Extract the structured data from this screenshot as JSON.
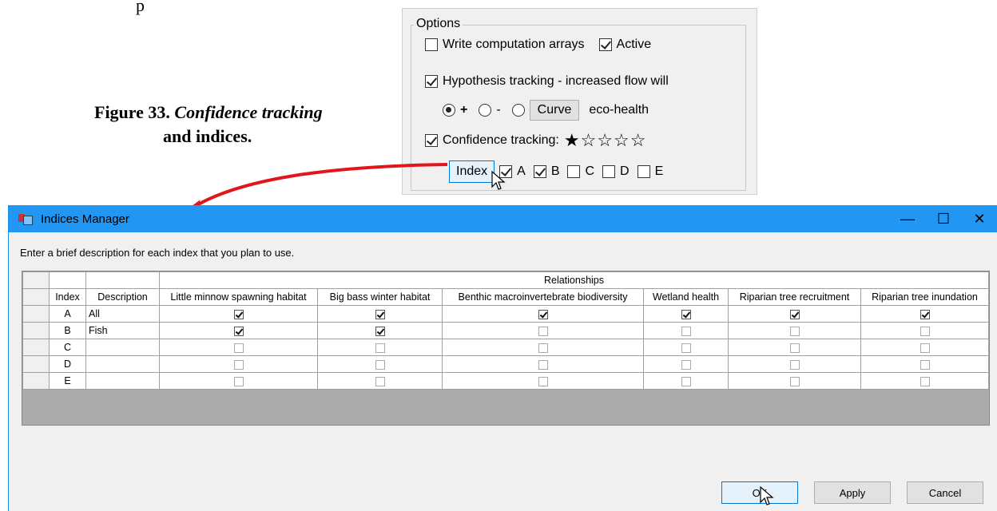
{
  "page_fragment": "p",
  "caption": {
    "figure_label": "Figure 33.",
    "italic_title": "Confidence tracking",
    "line2": "and indices."
  },
  "options_panel": {
    "title": "Options",
    "write_arrays_label": "Write computation arrays",
    "write_arrays_checked": false,
    "active_label": "Active",
    "active_checked": true,
    "hypothesis_label": "Hypothesis tracking - increased flow will",
    "hypothesis_checked": true,
    "radio_plus": "+",
    "radio_minus": "-",
    "selected_radio": "+",
    "curve_button": "Curve",
    "eco_label": "eco-health",
    "confidence_label": "Confidence tracking:",
    "confidence_checked": true,
    "stars": "★☆☆☆☆",
    "index_button": "Index",
    "index_checks": [
      {
        "label": "A",
        "checked": true
      },
      {
        "label": "B",
        "checked": true
      },
      {
        "label": "C",
        "checked": false
      },
      {
        "label": "D",
        "checked": false
      },
      {
        "label": "E",
        "checked": false
      }
    ]
  },
  "window": {
    "title": "Indices Manager",
    "instruction": "Enter a brief description for each index that you plan to use.",
    "controls": {
      "minimize": "—",
      "maximize": "☐",
      "close": "✕"
    },
    "grid": {
      "group_header": "Relationships",
      "col_index": "Index",
      "col_description": "Description",
      "relationships": [
        "Little minnow spawning habitat",
        "Big bass winter habitat",
        "Benthic macroinvertebrate biodiversity",
        "Wetland health",
        "Riparian tree recruitment",
        "Riparian tree inundation"
      ],
      "rows": [
        {
          "index": "A",
          "description": "All",
          "checks": [
            true,
            true,
            true,
            true,
            true,
            true
          ]
        },
        {
          "index": "B",
          "description": "Fish",
          "checks": [
            true,
            true,
            false,
            false,
            false,
            false
          ]
        },
        {
          "index": "C",
          "description": "",
          "checks": [
            false,
            false,
            false,
            false,
            false,
            false
          ]
        },
        {
          "index": "D",
          "description": "",
          "checks": [
            false,
            false,
            false,
            false,
            false,
            false
          ]
        },
        {
          "index": "E",
          "description": "",
          "checks": [
            false,
            false,
            false,
            false,
            false,
            false
          ]
        }
      ]
    },
    "buttons": {
      "ok": "OK",
      "apply": "Apply",
      "cancel": "Cancel"
    }
  },
  "colors": {
    "titlebar": "#2196f3",
    "arrow": "#e0161b",
    "default_button_border": "#0078d7"
  }
}
